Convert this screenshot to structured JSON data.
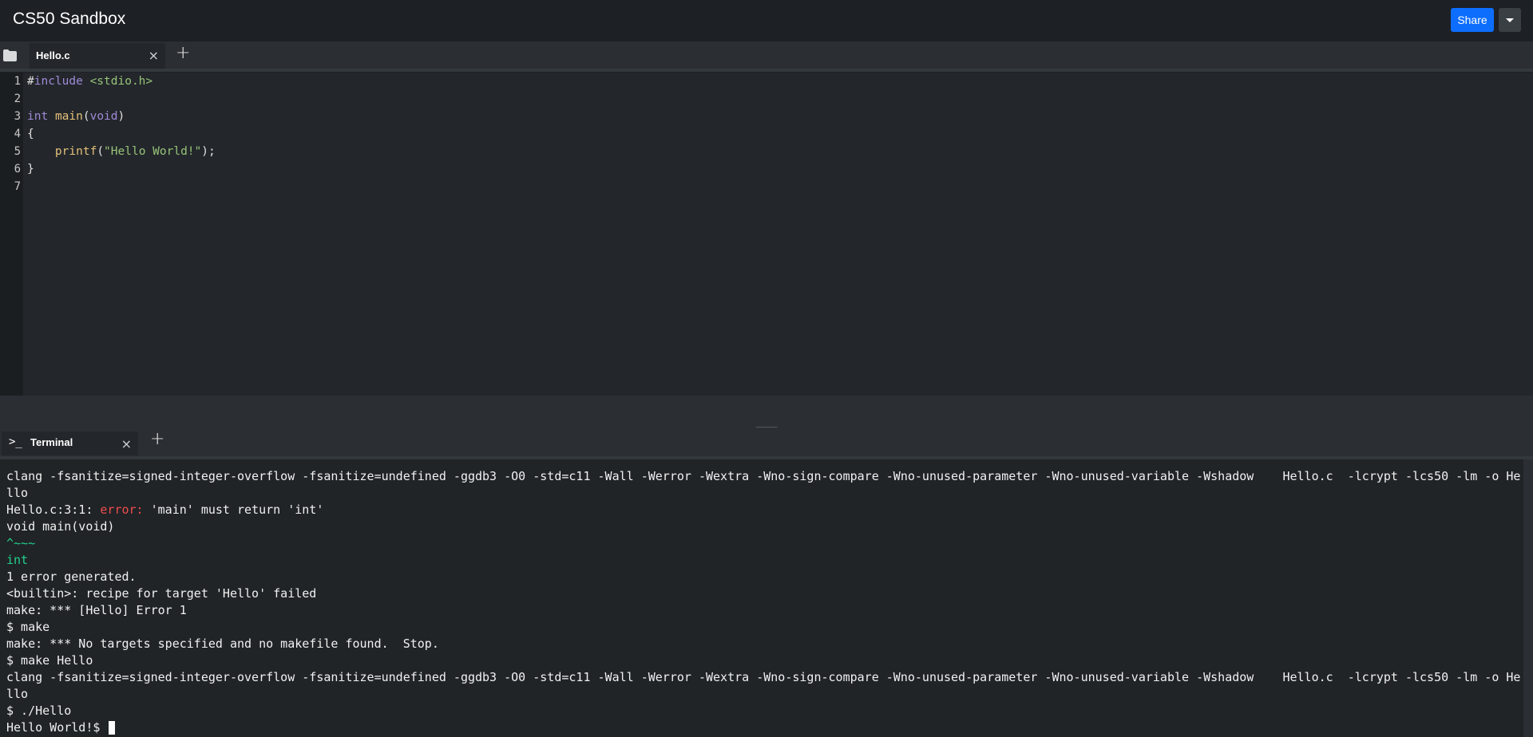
{
  "header": {
    "title": "CS50 Sandbox",
    "share_label": "Share",
    "dropdown_icon": "caret-down-icon"
  },
  "editor": {
    "file_tab": "Hello.c",
    "close_glyph": "×",
    "add_tab_glyph": "+",
    "line_numbers": [
      "1",
      "2",
      "3",
      "4",
      "5",
      "6",
      "7"
    ],
    "code": {
      "l1_hash": "#",
      "l1_include": "include",
      "l1_header": " <stdio.h>",
      "l3_type": "int",
      "l3_sp": " ",
      "l3_name": "main",
      "l3_open": "(",
      "l3_param": "void",
      "l3_close": ")",
      "l4": "{",
      "l5_indent": "    ",
      "l5_fn": "printf",
      "l5_open": "(",
      "l5_str": "\"Hello World!\"",
      "l5_close": ");",
      "l6": "}"
    }
  },
  "terminal": {
    "tab_icon": ">_",
    "tab_label": "Terminal",
    "close_glyph": "×",
    "add_tab_glyph": "+",
    "lines": {
      "l1": "clang -fsanitize=signed-integer-overflow -fsanitize=undefined -ggdb3 -O0 -std=c11 -Wall -Werror -Wextra -Wno-sign-compare -Wno-unused-parameter -Wno-unused-variable -Wshadow    Hello.c  -lcrypt -lcs50 -lm -o He",
      "l2": "llo",
      "l3_loc": "Hello.c:3:1: ",
      "l3_err": "error:",
      "l3_msg": " 'main' must return 'int'",
      "l4": "void main(void)",
      "l5": "^~~~",
      "l6": "int",
      "l7": "1 error generated.",
      "l8": "<builtin>: recipe for target 'Hello' failed",
      "l9": "make: *** [Hello] Error 1",
      "l10": "$ make",
      "l11": "make: *** No targets specified and no makefile found.  Stop.",
      "l12": "$ make Hello",
      "l13": "clang -fsanitize=signed-integer-overflow -fsanitize=undefined -ggdb3 -O0 -std=c11 -Wall -Werror -Wextra -Wno-sign-compare -Wno-unused-parameter -Wno-unused-variable -Wshadow    Hello.c  -lcrypt -lcs50 -lm -o He",
      "l14": "llo",
      "l15": "$ ./Hello",
      "l16": "Hello World!$ "
    }
  },
  "colors": {
    "accent": "#0d6efd",
    "error": "#f14c4c",
    "hint": "#23d18b",
    "keyword": "#a08ad8",
    "function": "#e5c07b",
    "string": "#98c379"
  }
}
